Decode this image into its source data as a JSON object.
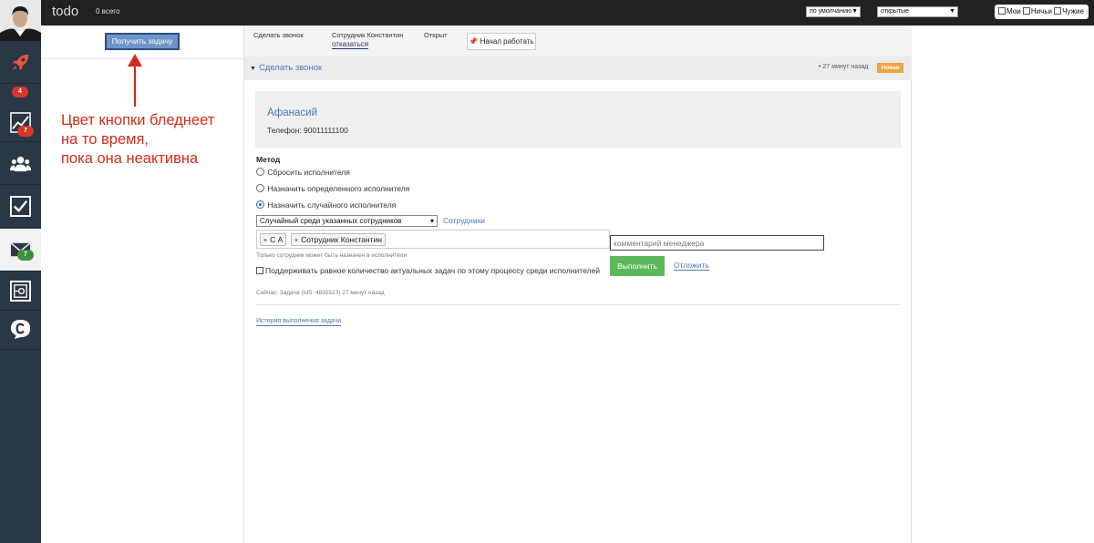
{
  "topbar": {
    "title": "todo",
    "count_text": "0 всего",
    "sort_select": "по умолчанию",
    "status_select": "открытые",
    "filters": [
      "Мои",
      "Ничьи",
      "Чужие"
    ]
  },
  "sidebar": {
    "items": [
      {
        "icon": "rocket-icon"
      },
      {
        "icon": "chart-icon",
        "badge": "4"
      },
      {
        "icon": "users-icon",
        "badge": "7"
      },
      {
        "icon": "checkbox-icon"
      },
      {
        "icon": "mail-icon",
        "badge": "7"
      },
      {
        "icon": "safe-icon"
      },
      {
        "icon": "chat-icon"
      }
    ],
    "colors": {
      "background": "#2a3744",
      "badge_red": "#d8352a",
      "badge_green": "#3e8e3e"
    }
  },
  "left_panel": {
    "get_task_label": "Получить задачу",
    "annotation_lines": [
      "Цвет кнопки бледнеет",
      "на то время,",
      "пока она неактивна"
    ],
    "annotation_color": "#d42a1b"
  },
  "tab_strip": {
    "task_type": "Сделать звонок",
    "employee": "Сотрудник Константин",
    "decline_link": "отказаться",
    "status": "Открыт",
    "start_button": "Начал работать"
  },
  "task": {
    "title": "Сделать звонок",
    "time_ago": "• 27 минут назад",
    "badge": "Новая",
    "contact_name": "Афанасий",
    "contact_phone": "Телефон: 90011111100"
  },
  "form": {
    "method_label": "Метод",
    "radio_options": [
      {
        "label": "Сбросить исполнителя",
        "selected": false
      },
      {
        "label": "Назначить определенного исполнителя",
        "selected": false
      },
      {
        "label": "Назначить случайного исполнителя",
        "selected": true
      }
    ],
    "strategy_select": "Случайный среди указанных сотрудников",
    "staff_link": "Сотрудники",
    "tags": [
      "С А",
      "Сотрудник Константин"
    ],
    "comment_placeholder": "комментарий менеджера",
    "hint": "Только сотрудник может быть назначен в исполнители",
    "balance_checkbox": "Поддерживать равное количество актуальных задач по этому процессу среди исполнителей",
    "submit_label": "Выполнить",
    "postpone_label": "Отложить",
    "now_line": "Сейчас: Задача (IdS: 4835523) 27 минут назад",
    "history_link": "История выполнения задачи",
    "accent_color": "#5cb85c"
  }
}
